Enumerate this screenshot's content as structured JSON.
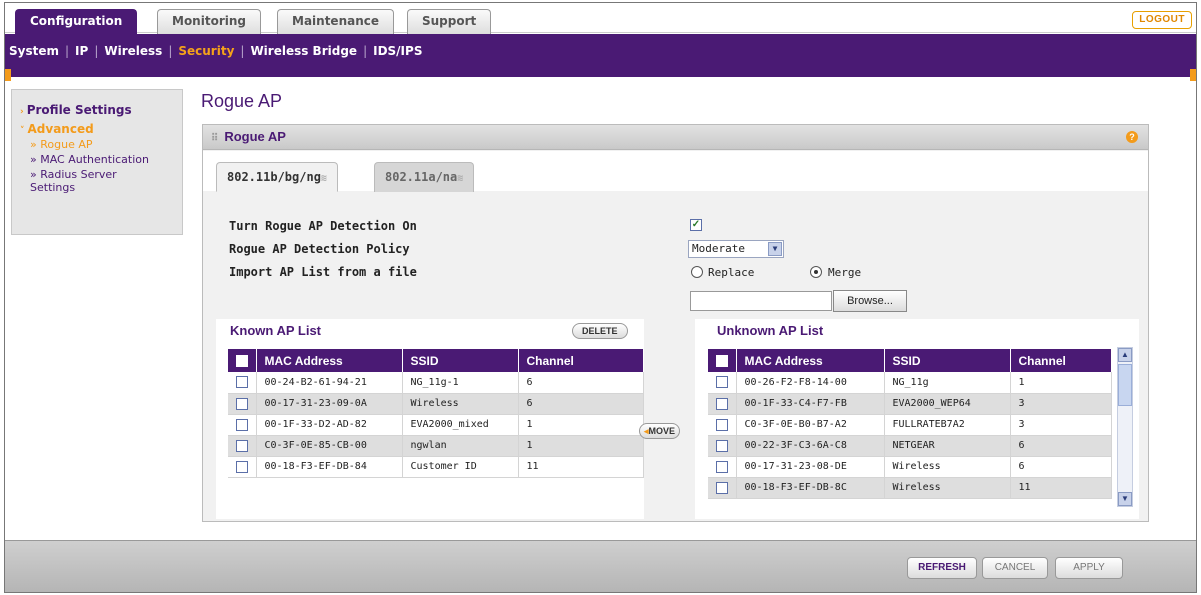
{
  "top_tabs": [
    "Configuration",
    "Monitoring",
    "Maintenance",
    "Support"
  ],
  "logout_label": "LOGOUT",
  "subnav": [
    "System",
    "IP",
    "Wireless",
    "Security",
    "Wireless Bridge",
    "IDS/IPS"
  ],
  "subnav_active": "Security",
  "sidebar": {
    "profile_settings": "Profile Settings",
    "advanced": "Advanced",
    "items": [
      "Rogue AP",
      "MAC Authentication",
      "Radius Server Settings"
    ],
    "active_item": "Rogue AP"
  },
  "page_title": "Rogue AP",
  "panel_title": "Rogue AP",
  "radio_tabs": [
    "802.11b/bg/ng",
    "802.11a/na"
  ],
  "form": {
    "detection_label": "Turn Rogue AP Detection On",
    "detection_checked": true,
    "policy_label": "Rogue AP Detection Policy",
    "policy_value": "Moderate",
    "import_label": "Import AP List from a file",
    "replace_label": "Replace",
    "merge_label": "Merge",
    "selected_import_mode": "Merge",
    "file_value": "",
    "browse_label": "Browse..."
  },
  "known": {
    "title": "Known AP List",
    "delete_label": "DELETE",
    "columns": [
      "MAC Address",
      "SSID",
      "Channel"
    ],
    "rows": [
      [
        "00-24-B2-61-94-21",
        "NG_11g-1",
        "6"
      ],
      [
        "00-17-31-23-09-0A",
        "Wireless",
        "6"
      ],
      [
        "00-1F-33-D2-AD-82",
        "EVA2000_mixed",
        "1"
      ],
      [
        "C0-3F-0E-85-CB-00",
        "ngwlan",
        "1"
      ],
      [
        "00-18-F3-EF-DB-84",
        "Customer ID",
        "11"
      ]
    ]
  },
  "move_label": "MOVE",
  "unknown": {
    "title": "Unknown AP List",
    "columns": [
      "MAC Address",
      "SSID",
      "Channel"
    ],
    "rows": [
      [
        "00-26-F2-F8-14-00",
        "NG_11g",
        "1"
      ],
      [
        "00-1F-33-C4-F7-FB",
        "EVA2000_WEP64",
        "3"
      ],
      [
        "C0-3F-0E-B0-B7-A2",
        "FULLRATEB7A2",
        "3"
      ],
      [
        "00-22-3F-C3-6A-C8",
        "NETGEAR",
        "6"
      ],
      [
        "00-17-31-23-08-DE",
        "Wireless",
        "6"
      ],
      [
        "00-18-F3-EF-DB-8C",
        "Wireless",
        "11"
      ]
    ]
  },
  "footer_buttons": {
    "refresh": "REFRESH",
    "cancel": "CANCEL",
    "apply": "APPLY"
  }
}
